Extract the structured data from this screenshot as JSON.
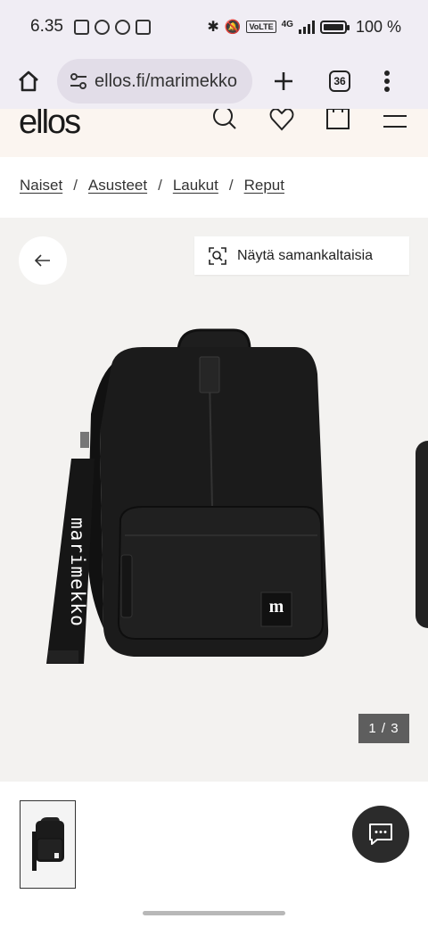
{
  "status_bar": {
    "time": "6.35",
    "battery": "100 %",
    "network": "4G"
  },
  "browser": {
    "url": "ellos.fi/marimekko",
    "tab_count": "36"
  },
  "site": {
    "logo": "ellos"
  },
  "breadcrumb": [
    {
      "label": "Naiset"
    },
    {
      "label": "Asusteet"
    },
    {
      "label": "Laukut"
    },
    {
      "label": "Reput"
    }
  ],
  "gallery": {
    "similar_label": "Näytä samankaltaisia",
    "counter": "1 / 3",
    "strap_text": "marimekko",
    "patch_letter": "m"
  },
  "icons": {
    "home": "home-icon",
    "tune": "site-settings-icon",
    "plus": "new-tab-icon",
    "menu": "more-vert-icon",
    "search": "search-icon",
    "heart": "wishlist-icon",
    "bag": "cart-icon",
    "hamburger": "menu-icon",
    "back": "arrow-left-icon",
    "visual_search": "visual-search-icon",
    "chat": "chat-icon"
  },
  "colors": {
    "status_bg": "#f0edf4",
    "header_bg": "#fbf5f0",
    "gallery_bg": "#f3f2f0",
    "counter_bg": "#5e5e5e",
    "chat_bg": "#2b2b2b"
  }
}
